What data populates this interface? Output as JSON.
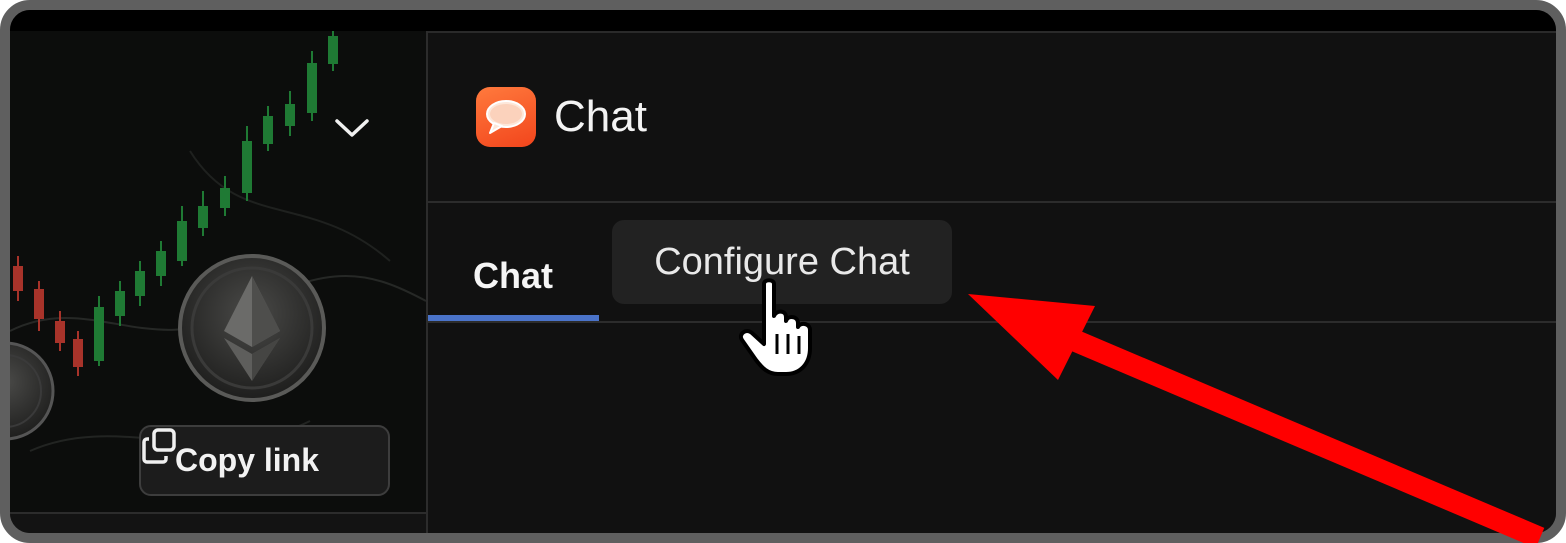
{
  "app": {
    "title": "Chat",
    "icon": "chat-bubble-icon",
    "icon_color": "#f2451c"
  },
  "tabs": [
    {
      "label": "Chat",
      "active": true
    },
    {
      "label": "Configure Chat",
      "active": false,
      "hovered": true
    }
  ],
  "thumbnail": {
    "copy_link_label": "Copy link",
    "copy_icon": "copy-icon",
    "toggle_icon": "chevron-down-icon"
  },
  "colors": {
    "active_tab_indicator": "#4a73c9",
    "annotation_arrow": "#ff0000",
    "candle_up": "#1f7a34",
    "candle_down": "#a8332a"
  }
}
